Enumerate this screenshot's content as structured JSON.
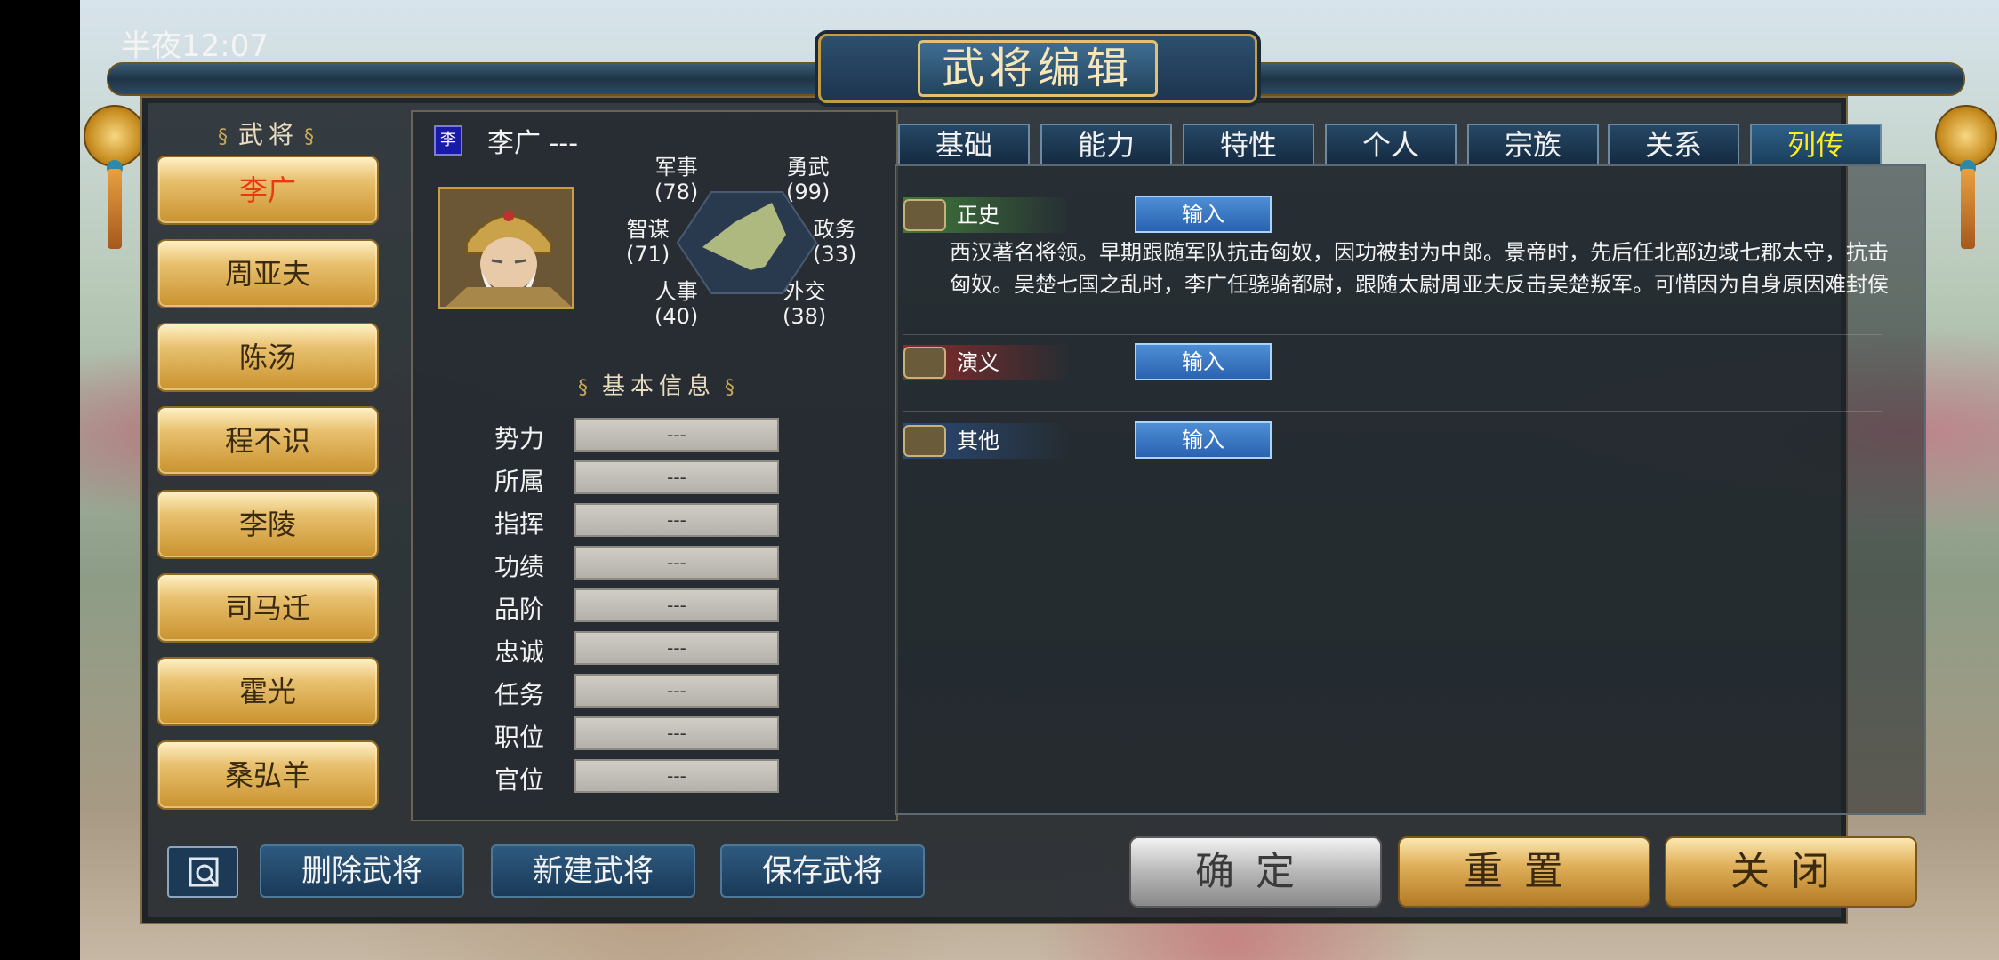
{
  "status": {
    "time": "半夜12:07"
  },
  "window": {
    "title": "武将编辑"
  },
  "general_list": {
    "heading": "武将",
    "items": [
      "李广",
      "周亚夫",
      "陈汤",
      "程不识",
      "李陵",
      "司马迁",
      "霍光",
      "桑弘羊"
    ],
    "selected_index": 0
  },
  "selected": {
    "faction_badge": "李",
    "name": "李广",
    "title_suffix": "---",
    "portrait_icon": "general-portrait",
    "stats": {
      "military": {
        "label": "军事",
        "value": "(78)"
      },
      "valor": {
        "label": "勇武",
        "value": "(99)"
      },
      "strategy": {
        "label": "智谋",
        "value": "(71)"
      },
      "politics": {
        "label": "政务",
        "value": "(33)"
      },
      "personnel": {
        "label": "人事",
        "value": "(40)"
      },
      "diplomacy": {
        "label": "外交",
        "value": "(38)"
      }
    }
  },
  "basic_info": {
    "heading": "基本信息",
    "fields": [
      {
        "label": "势力",
        "value": "---"
      },
      {
        "label": "所属",
        "value": "---"
      },
      {
        "label": "指挥",
        "value": "---"
      },
      {
        "label": "功绩",
        "value": "---"
      },
      {
        "label": "品阶",
        "value": "---"
      },
      {
        "label": "忠诚",
        "value": "---"
      },
      {
        "label": "任务",
        "value": "---"
      },
      {
        "label": "职位",
        "value": "---"
      },
      {
        "label": "官位",
        "value": "---"
      }
    ]
  },
  "tabs": [
    "基础",
    "能力",
    "特性",
    "个人",
    "宗族",
    "关系",
    "列传"
  ],
  "active_tab": "列传",
  "biography": {
    "sections": [
      {
        "label": "正史",
        "button": "输入",
        "color": "#3f7a3a"
      },
      {
        "label": "演义",
        "button": "输入",
        "color": "#8a2a2a"
      },
      {
        "label": "其他",
        "button": "输入",
        "color": "#2a4a7a"
      }
    ],
    "official_text": "西汉著名将领。早期跟随军队抗击匈奴，因功被封为中郎。景帝时，先后任北部边域七郡太守，抗击匈奴。吴楚七国之乱时，李广任骁骑都尉，跟随太尉周亚夫反击吴楚叛军。可惜因为自身原因难封侯"
  },
  "bottom": {
    "search_icon": "search-icon",
    "delete": "删除武将",
    "create": "新建武将",
    "save": "保存武将",
    "confirm": "确定",
    "reset": "重置",
    "close": "关闭"
  },
  "colors": {
    "active_tab_text": "#ffee22",
    "selected_general_text": "#e83a10",
    "input_button": "#2a62b0"
  }
}
